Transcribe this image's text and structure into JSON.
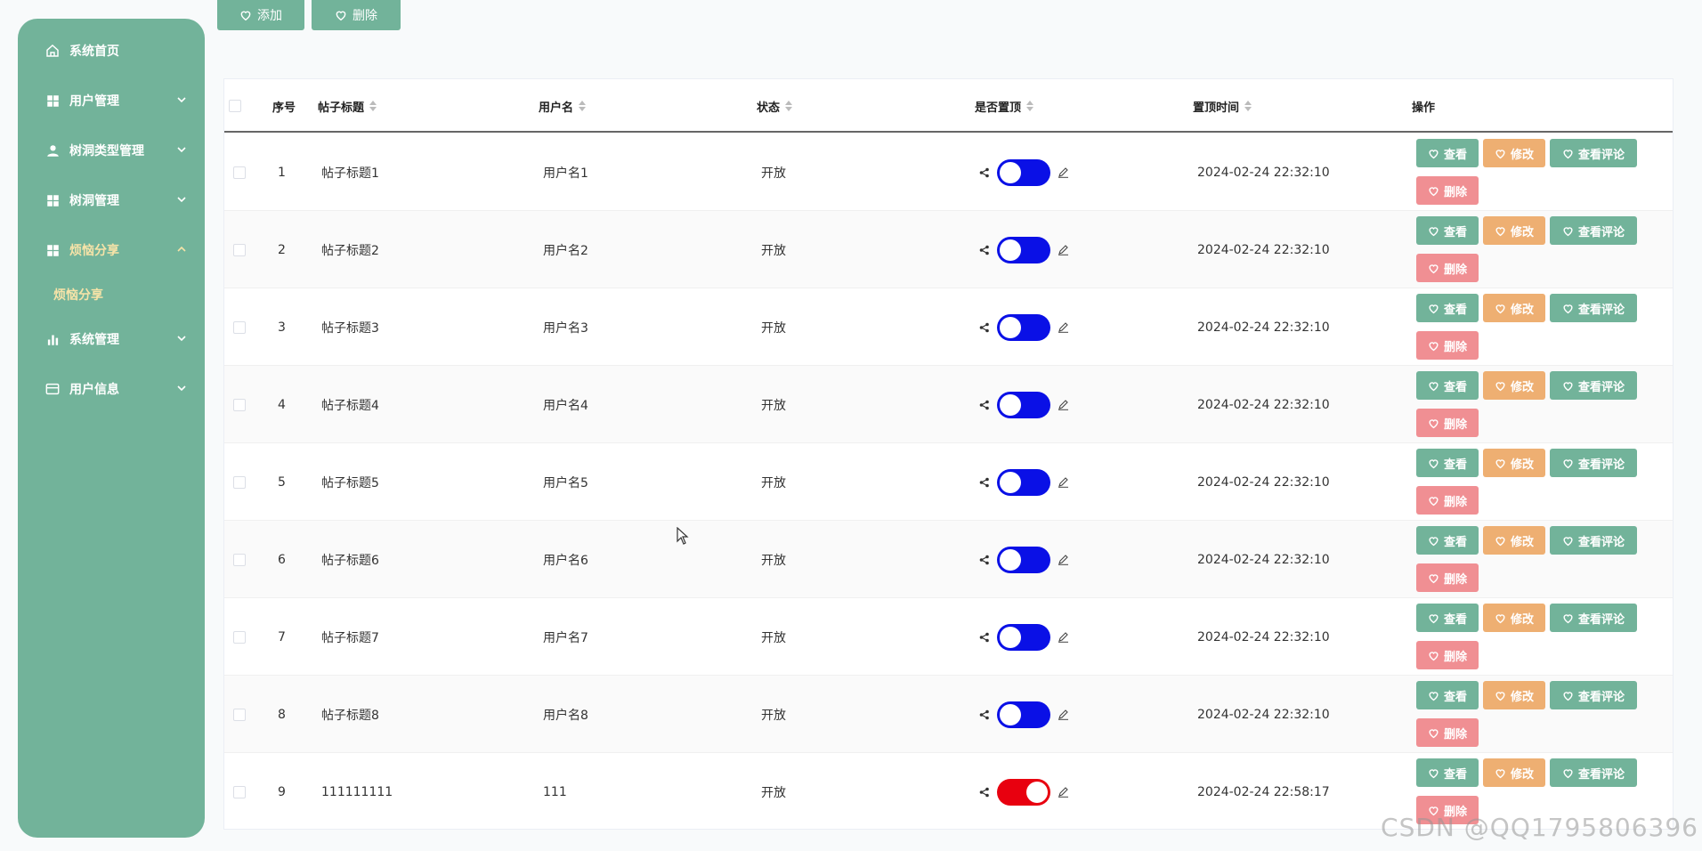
{
  "sidebar": {
    "items": [
      {
        "label": "系统首页",
        "icon": "home-icon",
        "expandable": false
      },
      {
        "label": "用户管理",
        "icon": "grid-icon",
        "expandable": true
      },
      {
        "label": "树洞类型管理",
        "icon": "user-icon",
        "expandable": true
      },
      {
        "label": "树洞管理",
        "icon": "grid-icon",
        "expandable": true
      },
      {
        "label": "烦恼分享",
        "icon": "grid-icon",
        "expandable": true,
        "active": true
      },
      {
        "label": "系统管理",
        "icon": "bar-chart-icon",
        "expandable": true
      },
      {
        "label": "用户信息",
        "icon": "card-icon",
        "expandable": true
      }
    ],
    "sub_item": "烦恼分享"
  },
  "toolbar": {
    "add_label": "添加",
    "delete_label": "删除"
  },
  "table": {
    "headers": {
      "index": "序号",
      "title": "帖子标题",
      "username": "用户名",
      "status": "状态",
      "pinned": "是否置顶",
      "pin_time": "置顶时间",
      "actions": "操作"
    },
    "rows": [
      {
        "index": "1",
        "title": "帖子标题1",
        "username": "用户名1",
        "status": "开放",
        "pinned": true,
        "pin_time": "2024-02-24 22:32:10"
      },
      {
        "index": "2",
        "title": "帖子标题2",
        "username": "用户名2",
        "status": "开放",
        "pinned": true,
        "pin_time": "2024-02-24 22:32:10"
      },
      {
        "index": "3",
        "title": "帖子标题3",
        "username": "用户名3",
        "status": "开放",
        "pinned": true,
        "pin_time": "2024-02-24 22:32:10"
      },
      {
        "index": "4",
        "title": "帖子标题4",
        "username": "用户名4",
        "status": "开放",
        "pinned": true,
        "pin_time": "2024-02-24 22:32:10"
      },
      {
        "index": "5",
        "title": "帖子标题5",
        "username": "用户名5",
        "status": "开放",
        "pinned": true,
        "pin_time": "2024-02-24 22:32:10"
      },
      {
        "index": "6",
        "title": "帖子标题6",
        "username": "用户名6",
        "status": "开放",
        "pinned": true,
        "pin_time": "2024-02-24 22:32:10"
      },
      {
        "index": "7",
        "title": "帖子标题7",
        "username": "用户名7",
        "status": "开放",
        "pinned": true,
        "pin_time": "2024-02-24 22:32:10"
      },
      {
        "index": "8",
        "title": "帖子标题8",
        "username": "用户名8",
        "status": "开放",
        "pinned": true,
        "pin_time": "2024-02-24 22:32:10"
      },
      {
        "index": "9",
        "title": "111111111",
        "username": "111",
        "status": "开放",
        "pinned": false,
        "pin_time": "2024-02-24 22:58:17"
      }
    ],
    "action_labels": {
      "view": "查看",
      "edit": "修改",
      "view_comments": "查看评论",
      "delete": "删除"
    }
  },
  "colors": {
    "sidebar_bg": "#72b39a",
    "active_text": "#f6e3a8",
    "toggle_on": "#0a10e6",
    "toggle_off": "#e8000f",
    "view_btn": "#72b39a",
    "edit_btn": "#eeaf72",
    "delete_btn": "#f08f93"
  },
  "watermark": "CSDN @QQ1795806396"
}
